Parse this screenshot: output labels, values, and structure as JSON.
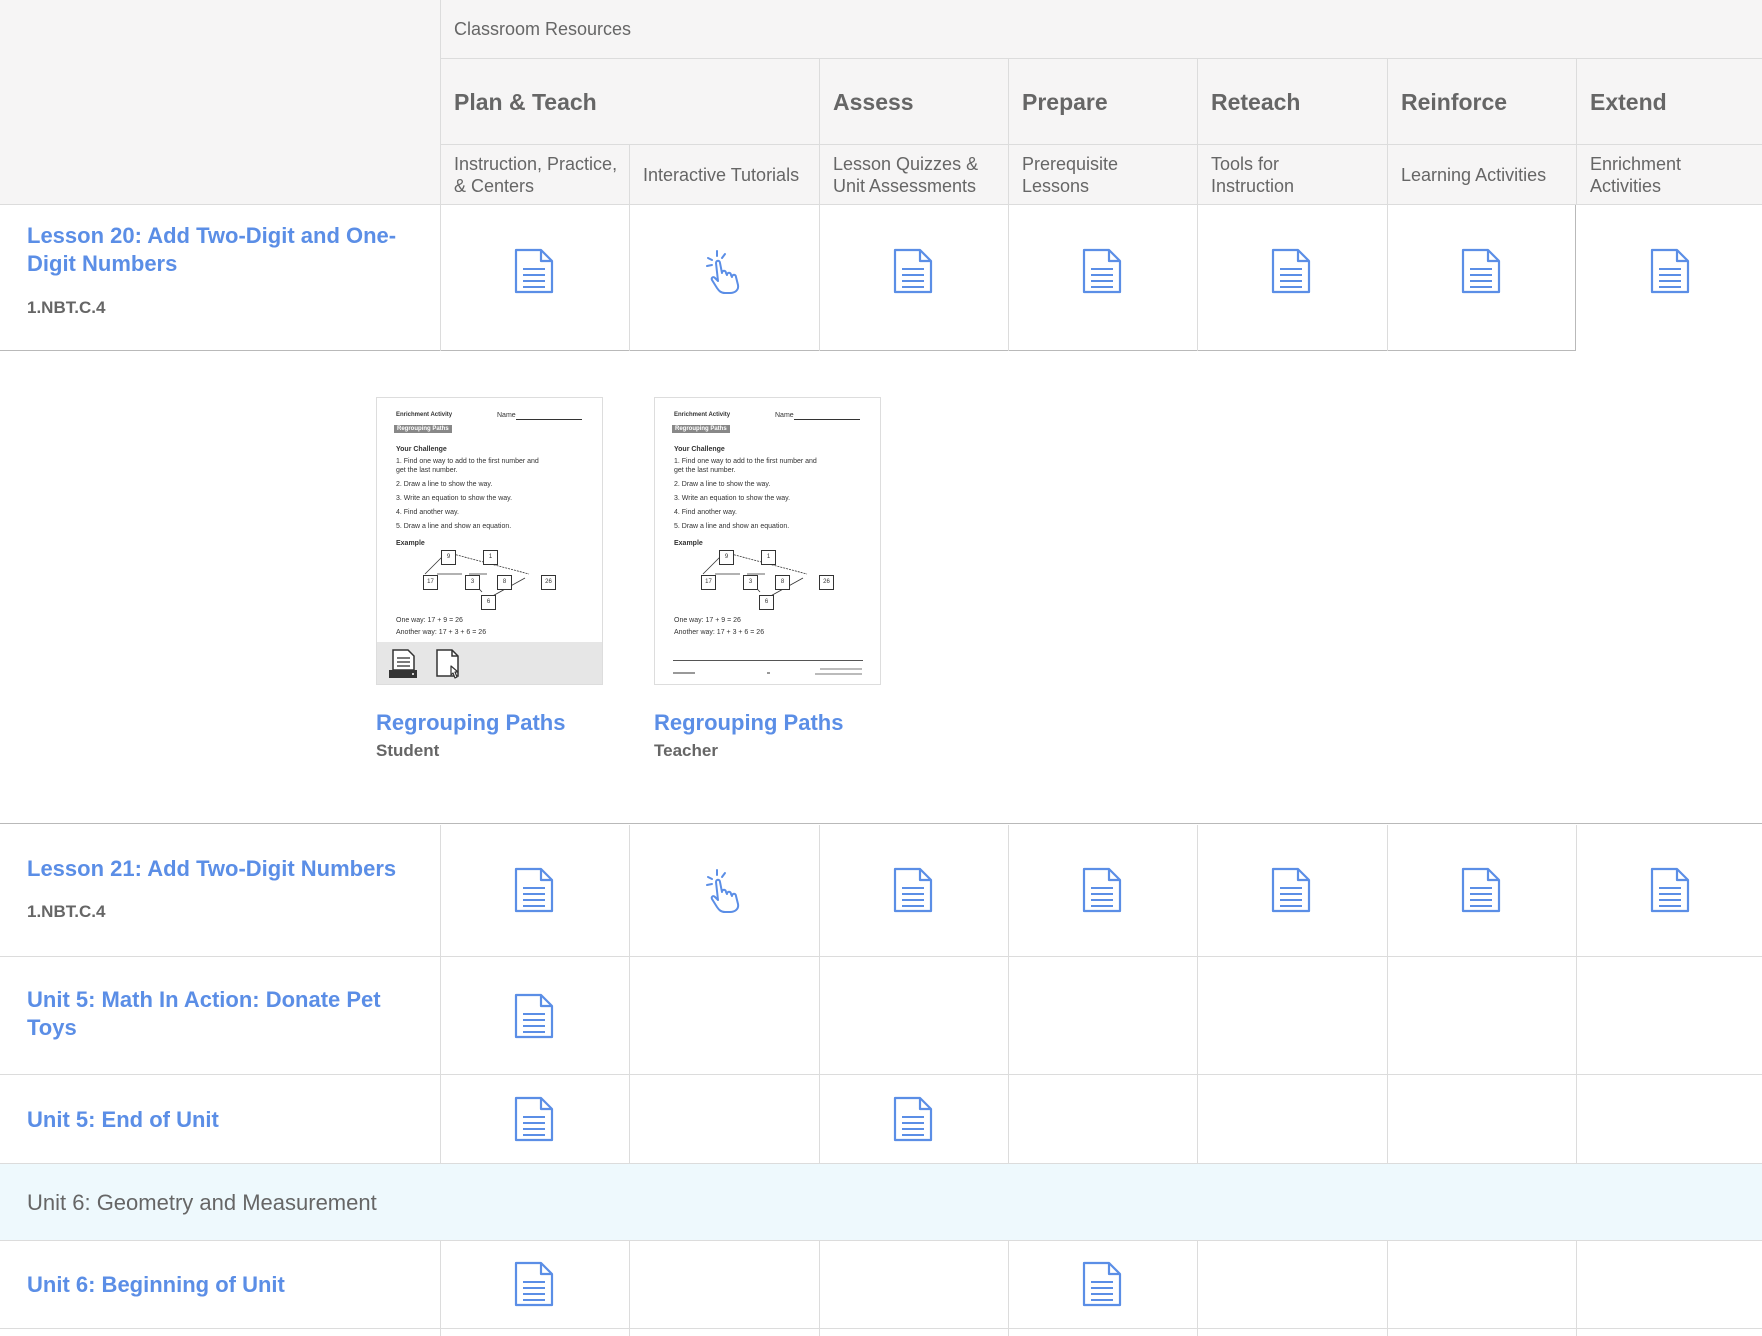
{
  "header": {
    "group_label": "Classroom Resources",
    "categories": [
      {
        "label": "Plan & Teach"
      },
      {
        "label": "Assess"
      },
      {
        "label": "Prepare"
      },
      {
        "label": "Reteach"
      },
      {
        "label": "Reinforce"
      },
      {
        "label": "Extend"
      }
    ],
    "subcolumns": [
      {
        "label": "Instruction, Practice, & Centers"
      },
      {
        "label": "Interactive Tutorials"
      },
      {
        "label": "Lesson Quizzes & Unit Assessments"
      },
      {
        "label": "Prerequisite Lessons"
      },
      {
        "label": "Tools for Instruction"
      },
      {
        "label": "Learning Activities"
      },
      {
        "label": "Enrichment Activities"
      }
    ]
  },
  "rows": [
    {
      "title": "Lesson 20: Add Two-Digit and One-Digit Numbers",
      "standard": "1.NBT.C.4",
      "resources": [
        "document-icon",
        "interactive-hand-icon",
        "document-icon",
        "document-icon",
        "document-icon",
        "document-icon",
        "document-icon"
      ]
    },
    {
      "title": "Lesson 21: Add Two-Digit Numbers",
      "standard": "1.NBT.C.4",
      "resources": [
        "document-icon",
        "interactive-hand-icon",
        "document-icon",
        "document-icon",
        "document-icon",
        "document-icon",
        "document-icon"
      ]
    },
    {
      "title": "Unit 5: Math In Action: Donate Pet Toys",
      "resources": [
        "document-icon",
        "",
        "",
        "",
        "",
        "",
        ""
      ]
    },
    {
      "title": "Unit 5: End of Unit",
      "resources": [
        "document-icon",
        "",
        "document-icon",
        "",
        "",
        "",
        ""
      ]
    },
    {
      "unit_header": "Unit 6: Geometry and Measurement"
    },
    {
      "title": "Unit 6: Beginning of Unit",
      "resources": [
        "document-icon",
        "",
        "",
        "document-icon",
        "",
        "",
        ""
      ]
    }
  ],
  "expanded_panel": {
    "cards": [
      {
        "title": "Regrouping Paths",
        "subtitle": "Student",
        "thumbnail": {
          "header_left": "Enrichment Activity",
          "name_label": "Name",
          "tag": "Regrouping Paths",
          "challenge_heading": "Your Challenge",
          "steps": [
            "1. Find one way to add to the first number and get the last number.",
            "2. Draw a line to show the way.",
            "3. Write an equation to show the way.",
            "4. Find another way.",
            "5. Draw a line and show an equation."
          ],
          "example_heading": "Example",
          "boxes": [
            "9",
            "1",
            "17",
            "3",
            "8",
            "26",
            "6"
          ],
          "line1": "One way: 17 + 9 = 26",
          "line2": "Another way: 17 + 3 + 6 = 26",
          "actions": [
            "print-icon",
            "open-document-icon"
          ]
        }
      },
      {
        "title": "Regrouping Paths",
        "subtitle": "Teacher",
        "thumbnail": {
          "header_left": "Enrichment Activity",
          "name_label": "Name",
          "tag": "Regrouping Paths",
          "challenge_heading": "Your Challenge",
          "steps": [
            "1. Find one way to add to the first number and get the last number.",
            "2. Draw a line to show the way.",
            "3. Write an equation to show the way.",
            "4. Find another way.",
            "5. Draw a line and show an equation."
          ],
          "example_heading": "Example",
          "boxes": [
            "9",
            "1",
            "17",
            "3",
            "8",
            "26",
            "6"
          ],
          "line1": "One way: 17 + 9 = 26",
          "line2": "Another way: 17 + 3 + 6 = 26"
        }
      }
    ]
  }
}
